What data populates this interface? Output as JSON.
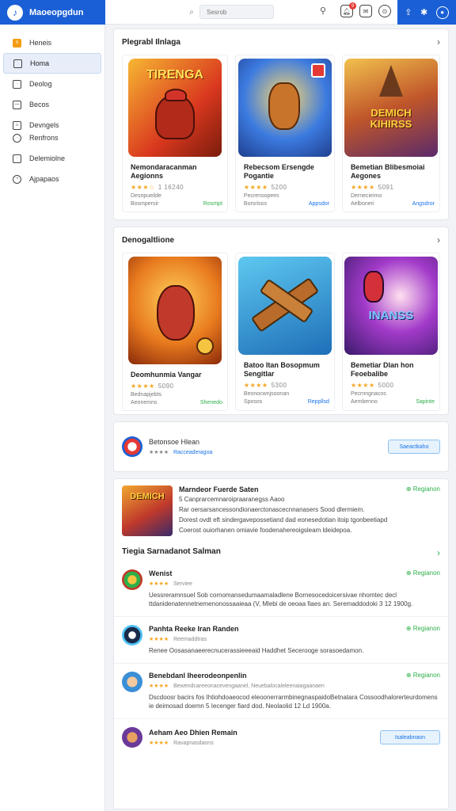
{
  "brand": {
    "name": "Maoeopgdun"
  },
  "search": {
    "placeholder": "Sesrob"
  },
  "top_badge": "9",
  "sidebar": {
    "items": [
      {
        "label": "Heneis"
      },
      {
        "label": "Homa"
      },
      {
        "label": "Deolog"
      },
      {
        "label": "Becos"
      },
      {
        "label": "Devngels"
      },
      {
        "label": "Renfrons"
      },
      {
        "label": "Delemiolne"
      },
      {
        "label": "Ajpapaos"
      }
    ]
  },
  "section1": {
    "title": "Plegrabl Ilnlaga",
    "games": [
      {
        "thumb_text": "TIRENGA",
        "title": "Nemondaracanman Aegionns",
        "stars": "★★★☆",
        "count": "1 16240",
        "line": "Desnpueilde",
        "foot_left": "Bosmpersir",
        "foot_right": "Rosmpt"
      },
      {
        "thumb_text": "",
        "title": "Rebecsom Ersengde Pogantie",
        "stars": "★★★★",
        "count": "5200",
        "line": "Pecrensopees",
        "foot_left": "Borsrisos",
        "foot_right": "Appsdor"
      },
      {
        "thumb_text": "DEMICH KIHIRSS",
        "title": "Bemetian Blibesmoiai Aegones",
        "stars": "★★★★",
        "count": "5091",
        "line": "Dernecieimo",
        "foot_left": "Aelboneri",
        "foot_right": "Angsdror"
      }
    ]
  },
  "section2": {
    "title": "Denogaltlione",
    "games": [
      {
        "thumb_text": "",
        "title": "Deomhunmia Vangar",
        "stars": "★★★★",
        "count": "5090",
        "line": "Bednapjebts",
        "foot_left": "Aeonemns",
        "foot_right": "Shenedo"
      },
      {
        "thumb_text": "",
        "title": "Batoo Itan Bosopmum Sengitlar",
        "stars": "★★★★",
        "count": "5300",
        "line": "Beonocwnjsoonan",
        "foot_left": "Sposos",
        "foot_right": "Reppllsd"
      },
      {
        "thumb_text": "INANSS",
        "title": "Bemetiar Dlan hon Feoebalibe",
        "stars": "★★★★",
        "count": "5000",
        "line": "Pecrnngnacos",
        "foot_left": "Aembenno",
        "foot_right": "Sapinte"
      }
    ]
  },
  "recommend": {
    "title": "Betonsoe Hlean",
    "meta": "Racceaderagoa",
    "button": "Saeactkaho"
  },
  "feature": {
    "thumb_text": "DEMICH",
    "title": "Marndeor Fuerde Saten",
    "line1": "5 Canprarcemnaroipraaranegss Aaoo",
    "line2": "Rar oersarsancessondionaerctonascecnnanasers Sood dlermiem.",
    "line3": "Dorest ovdt eft sindergavepossetiand dad eonesedotian itoip tgonbeetiapd",
    "line4": "Coerost ouiorhanen omiavie foodenahereoigsleam ldeidepoa.",
    "register": "Regianon"
  },
  "list": {
    "title": "Tiegia Sarnadanot Salman",
    "items": [
      {
        "title": "Wenist",
        "stars": "★★★★",
        "sub": "Serviee",
        "text": "Uessreramnsuel Sob cornomansedumaamaladlene Bornesocedoicersivae nhomtec decl ttdanidenatennetnemenonossaaieaa (V, Mlebi de oeoaa fiaes an. Seremaddodoki 3 12 1900g.",
        "action": "Regianon"
      },
      {
        "title": "Panhta Reeke Iran Randen",
        "stars": "★★★★",
        "sub": "Reemaddtras",
        "text": "Renee Oosasanaeerecnucerassieeeaid Haddhet Secerooge sorasoedamon.",
        "action": "Regianon"
      },
      {
        "title": "Benebdanl Iheerodeonpenlin",
        "stars": "★★★★",
        "sub": "Bewendcareeonacevengaanel, Neuebalocaleleenaiagaanaen",
        "text": "Dscdoosr bacirs fos Ihtiohdoaeocod eleoonerrarmbinegnaspaidoBetnatara Cossoodhalorerteurdomens ie deimosad doemn 5 Iecenger fiard dod. Neolaolid 12 Ld 1900a.",
        "action": "Regianon"
      },
      {
        "title": "Aeham Aeo Dhien Remain",
        "stars": "★★★★",
        "sub": "Ravapnasdaons",
        "text": "",
        "action": "Isaleabnaon"
      }
    ]
  }
}
